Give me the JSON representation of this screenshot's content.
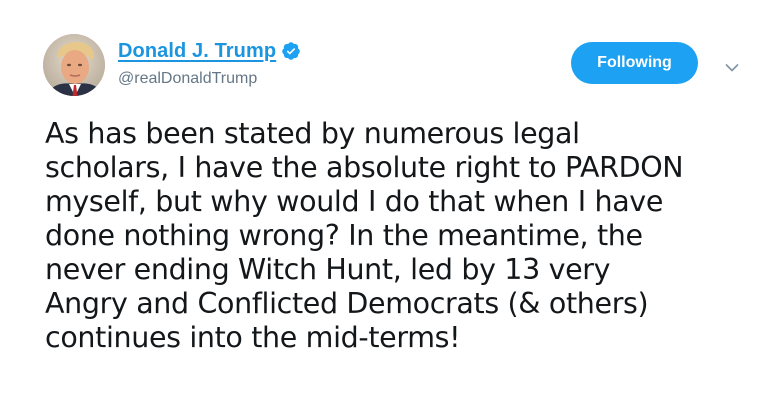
{
  "tweet": {
    "author": {
      "display_name": "Donald J. Trump",
      "screen_name": "@realDonaldTrump",
      "verified": true,
      "avatar_icon": "profile-photo"
    },
    "follow_button_label": "Following",
    "menu_icon": "chevron-down-icon",
    "text": "As has been stated by numerous legal\nscholars, I have the absolute right to PARDON\nmyself, but why would I do that when I have\ndone nothing wrong? In the meantime, the\nnever ending Witch Hunt, led by 13 very\nAngry and Conflicted Democrats (& others)\ncontinues into the mid-terms!"
  },
  "colors": {
    "brand_blue": "#1da1f2",
    "name_blue": "#1b95e0",
    "secondary_text": "#657786",
    "body_text": "#14171a"
  }
}
